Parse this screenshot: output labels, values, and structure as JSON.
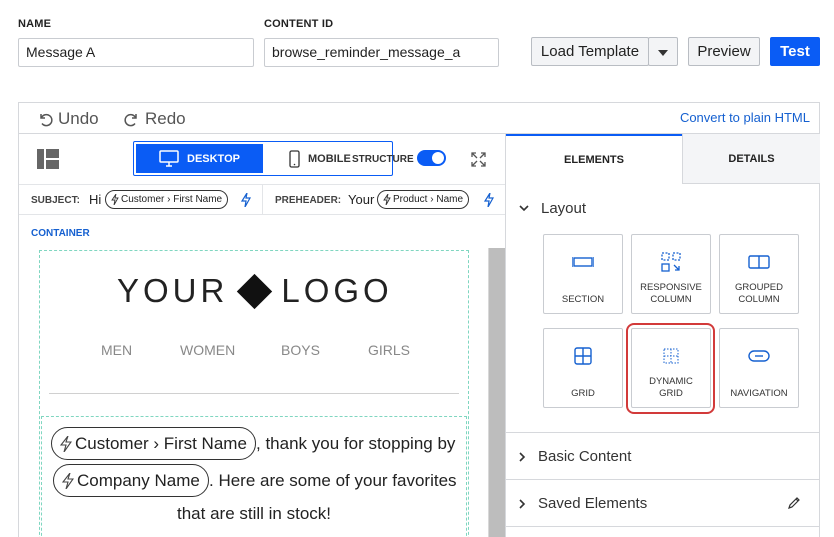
{
  "form": {
    "name_label": "NAME",
    "name_value": "Message A",
    "content_id_label": "CONTENT ID",
    "content_id_value": "browse_reminder_message_a",
    "load_template_label": "Load Template",
    "preview_label": "Preview",
    "test_label": "Test"
  },
  "editor": {
    "undo_label": "Undo",
    "redo_label": "Redo",
    "convert_label": "Convert to plain HTML",
    "desktop_label": "DESKTOP",
    "mobile_label": "MOBILE",
    "structure_label": "STRUCTURE",
    "structure_on": true,
    "subject_label": "SUBJECT:",
    "subject_prefix": "Hi",
    "subject_token": "Customer › First Name",
    "preheader_label": "PREHEADER:",
    "preheader_prefix": "Your",
    "preheader_token": "Product › Name",
    "container_label": "CONTAINER"
  },
  "canvas": {
    "logo_left": "YOUR",
    "logo_right": "LOGO",
    "nav": [
      "MEN",
      "WOMEN",
      "BOYS",
      "GIRLS"
    ],
    "token_first_name": "Customer › First Name",
    "text_1": ", thank you for stopping by",
    "token_company": "Company Name",
    "text_2": ". Here are some of your favorites",
    "text_3": "that are still in stock!"
  },
  "panel": {
    "tab_elements": "ELEMENTS",
    "tab_details": "DETAILS",
    "layout_label": "Layout",
    "cards": [
      {
        "label": "SECTION",
        "icon": "section-icon"
      },
      {
        "label": "RESPONSIVE COLUMN",
        "icon": "responsive-column-icon"
      },
      {
        "label": "GROUPED COLUMN",
        "icon": "grouped-column-icon"
      },
      {
        "label": "GRID",
        "icon": "grid-icon"
      },
      {
        "label": "DYNAMIC GRID",
        "icon": "dynamic-grid-icon"
      },
      {
        "label": "NAVIGATION",
        "icon": "navigation-icon"
      }
    ],
    "basic_content_label": "Basic Content",
    "saved_elements_label": "Saved Elements"
  },
  "colors": {
    "accent": "#0a5cf5",
    "highlight": "#d23a3a",
    "link": "#1560d0"
  }
}
